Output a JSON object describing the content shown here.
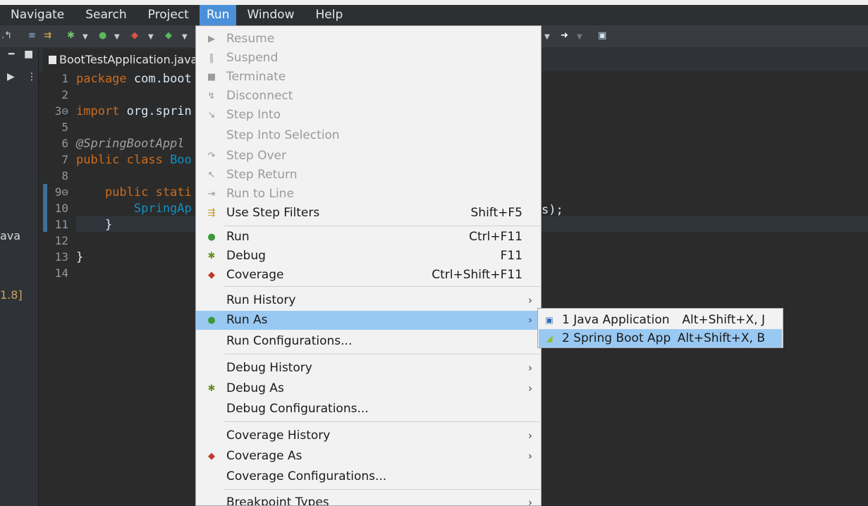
{
  "menubar": {
    "items": [
      {
        "label": "Navigate"
      },
      {
        "label": "Search"
      },
      {
        "label": "Project"
      },
      {
        "label": "Run"
      },
      {
        "label": "Window"
      },
      {
        "label": "Help"
      }
    ]
  },
  "editor": {
    "tab_title": "BootTestApplication.java",
    "lines": [
      "1",
      "2",
      "3",
      "5",
      "6",
      "7",
      "8",
      "9",
      "10",
      "11",
      "12",
      "13",
      "14"
    ],
    "line3_marker": "3⊖",
    "line9_marker": "9⊖",
    "code": {
      "l1_kw": "package",
      "l1_rest": " com.boot",
      "l3_kw": "import",
      "l3_rest": " org.sprin",
      "l6": "@SpringBootAppl",
      "l7_kw": "public class",
      "l7_cls": " Boo",
      "l9_kw": "    public stati",
      "l10_cls": "        SpringAp",
      "l11": "    }",
      "l13": "}",
      "right_fragment": "s);"
    }
  },
  "left_panel": {
    "text_ava": "ava",
    "text_version": "1.8]"
  },
  "run_menu": {
    "items": [
      {
        "label": "Resume",
        "enabled": false,
        "icon": "resume-icon"
      },
      {
        "label": "Suspend",
        "enabled": false,
        "icon": "suspend-icon"
      },
      {
        "label": "Terminate",
        "enabled": false,
        "icon": "terminate-icon"
      },
      {
        "label": "Disconnect",
        "enabled": false,
        "icon": "disconnect-icon"
      },
      {
        "label": "Step Into",
        "enabled": false,
        "icon": "step-into-icon"
      },
      {
        "label": "Step Into Selection",
        "enabled": false
      },
      {
        "label": "Step Over",
        "enabled": false,
        "icon": "step-over-icon"
      },
      {
        "label": "Step Return",
        "enabled": false,
        "icon": "step-return-icon"
      },
      {
        "label": "Run to Line",
        "enabled": false,
        "icon": "run-to-line-icon"
      },
      {
        "label": "Use Step Filters",
        "accel": "Shift+F5",
        "enabled": true,
        "icon": "step-filters-icon"
      },
      {
        "label": "Run",
        "accel": "Ctrl+F11",
        "enabled": true,
        "icon": "run-icon"
      },
      {
        "label": "Debug",
        "accel": "F11",
        "enabled": true,
        "icon": "debug-icon"
      },
      {
        "label": "Coverage",
        "accel": "Ctrl+Shift+F11",
        "enabled": true,
        "icon": "coverage-icon"
      },
      {
        "label": "Run History",
        "enabled": true
      },
      {
        "label": "Run As",
        "enabled": true,
        "icon": "run-as-icon"
      },
      {
        "label": "Run Configurations...",
        "enabled": true
      },
      {
        "label": "Debug History",
        "enabled": true
      },
      {
        "label": "Debug As",
        "enabled": true,
        "icon": "debug-as-icon"
      },
      {
        "label": "Debug Configurations...",
        "enabled": true
      },
      {
        "label": "Coverage History",
        "enabled": true
      },
      {
        "label": "Coverage As",
        "enabled": true,
        "icon": "coverage-as-icon"
      },
      {
        "label": "Coverage Configurations...",
        "enabled": true
      },
      {
        "label": "Breakpoint Types",
        "enabled": true
      }
    ]
  },
  "run_as_submenu": {
    "items": [
      {
        "label": "1 Java Application",
        "accel": "Alt+Shift+X, J",
        "icon": "java-application-icon"
      },
      {
        "label": "2 Spring Boot App",
        "accel": "Alt+Shift+X, B",
        "icon": "spring-boot-icon"
      }
    ]
  },
  "colors": {
    "menu_highlight": "#99c9f2",
    "menubar_active": "#4a90d9",
    "keyword": "#cc6c1d",
    "class": "#1290c3"
  }
}
